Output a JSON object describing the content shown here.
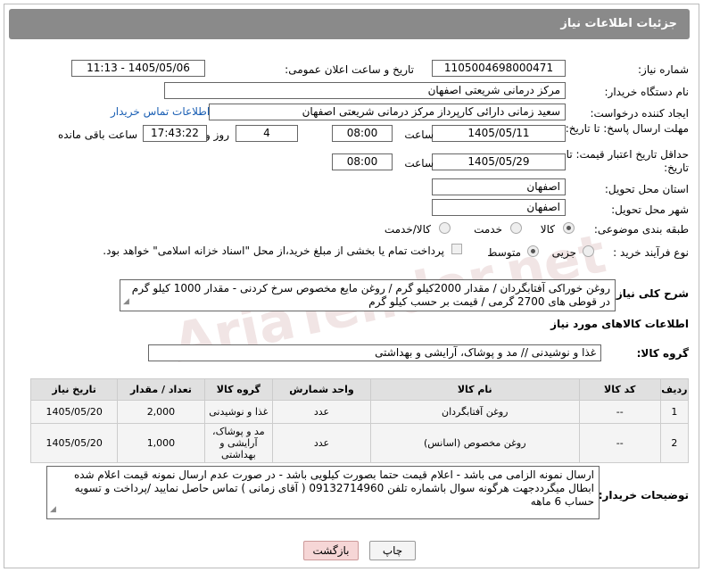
{
  "title": "جزئیات اطلاعات نیاز",
  "watermark": "AriaTender.net",
  "labels": {
    "need_number": "شماره نیاز:",
    "announce_datetime": "تاریخ و ساعت اعلان عمومی:",
    "buyer_org": "نام دستگاه خریدار:",
    "requester": "ایجاد کننده درخواست:",
    "reply_deadline": "مهلت ارسال پاسخ: تا تاریخ:",
    "time": "ساعت",
    "days_and": "روز و",
    "time_remaining": "ساعت باقی مانده",
    "price_validity": "حداقل تاریخ اعتبار قیمت: تا تاریخ:",
    "delivery_province": "استان محل تحویل:",
    "delivery_city": "شهر محل تحویل:",
    "category": "طبقه بندی موضوعی:",
    "process_type": "نوع فرآیند خرید :",
    "general_description": "شرح کلی نیاز:",
    "goods_info": "اطلاعات کالاهای مورد نیاز",
    "goods_group": "گروه کالا:",
    "buyer_notes": "توضیحات خریدار:"
  },
  "fields": {
    "need_number": "1105004698000471",
    "announce_datetime": "1405/05/06 - 11:13",
    "buyer_org": "مرکز درمانی شریعتی اصفهان",
    "requester": "سعید زمانی دارائی کارپرداز مرکز درمانی شریعتی اصفهان",
    "contact_link": "اطلاعات تماس خریدار",
    "reply_date": "1405/05/11",
    "reply_time": "08:00",
    "days": "4",
    "remaining": "17:43:22",
    "validity_date": "1405/05/29",
    "validity_time": "08:00",
    "province": "اصفهان",
    "city": "اصفهان",
    "general_description": "روغن خوراکی آفتابگردان / مقدار 2000کیلو گرم / روغن مایع مخصوص سرخ کردنی - مقدار 1000 کیلو گرم در قوطی های 2700 گرمی / قیمت بر حسب کیلو گرم",
    "goods_group": "غذا و نوشیدنی // مد و پوشاک، آرایشی و بهداشتی",
    "buyer_notes": "ارسال نمونه الزامی می باشد - اعلام قیمت حتما بصورت کیلویی باشد - در صورت عدم ارسال نمونه قیمت اعلام شده ابطال میگرددجهت هرگونه سوال باشماره تلفن 09132714960 ( آقای زمانی ) تماس حاصل نمایید /پرداخت و تسویه حساب 6 ماهه"
  },
  "category_options": [
    {
      "label": "کالا",
      "selected": true
    },
    {
      "label": "خدمت",
      "selected": false
    },
    {
      "label": "کالا/خدمت",
      "selected": false
    }
  ],
  "process_options": [
    {
      "label": "جزیی",
      "selected": false
    },
    {
      "label": "متوسط",
      "selected": true
    }
  ],
  "treasury_text": "پرداخت تمام یا بخشی از مبلغ خرید،از محل \"اسناد خزانه اسلامی\" خواهد بود.",
  "table": {
    "headers": [
      "ردیف",
      "کد کالا",
      "نام کالا",
      "واحد شمارش",
      "گروه کالا",
      "تعداد / مقدار",
      "تاریخ نیاز"
    ],
    "rows": [
      [
        "1",
        "--",
        "روغن آفتابگردان",
        "عدد",
        "غذا و نوشیدنی",
        "2,000",
        "1405/05/20"
      ],
      [
        "2",
        "--",
        "روغن مخصوص (اسانس)",
        "عدد",
        "مد و پوشاک، آرایشی و بهداشتی",
        "1,000",
        "1405/05/20"
      ]
    ]
  },
  "buttons": {
    "print": "چاپ",
    "back": "بازگشت"
  }
}
